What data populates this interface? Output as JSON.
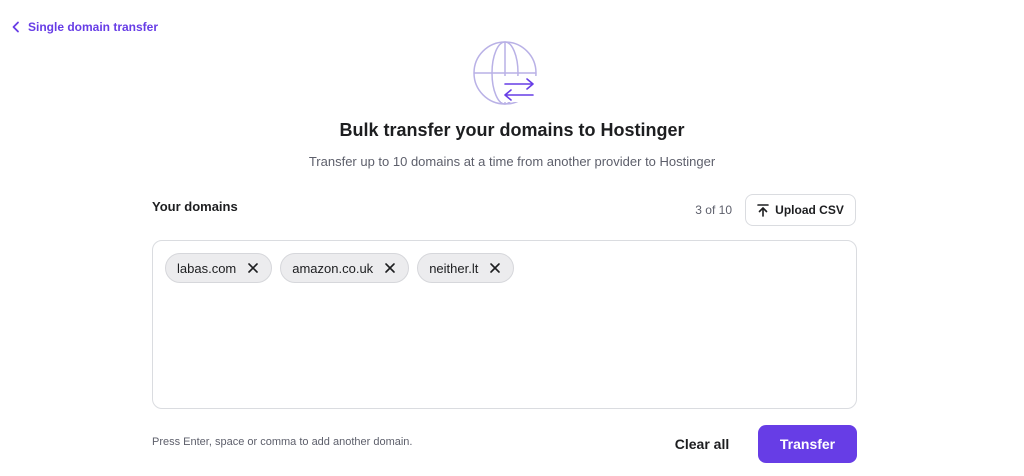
{
  "nav": {
    "back_label": "Single domain transfer",
    "back_icon": "chevron-left-icon"
  },
  "hero": {
    "icon": "globe-transfer-icon",
    "title": "Bulk transfer your domains to Hostinger",
    "subtitle": "Transfer up to 10 domains at a time from another provider to Hostinger"
  },
  "domains": {
    "label": "Your domains",
    "counter": "3 of 10",
    "upload_label": "Upload CSV",
    "upload_icon": "upload-icon",
    "items": [
      {
        "name": "labas.com"
      },
      {
        "name": "amazon.co.uk"
      },
      {
        "name": "neither.lt"
      }
    ],
    "hint": "Press Enter, space or comma to add another domain."
  },
  "actions": {
    "clear_label": "Clear all",
    "transfer_label": "Transfer"
  },
  "colors": {
    "accent": "#673de6",
    "text": "#1d1e20",
    "muted": "#5d5f6b",
    "chip_bg": "#ececee",
    "border": "#dadce0"
  }
}
